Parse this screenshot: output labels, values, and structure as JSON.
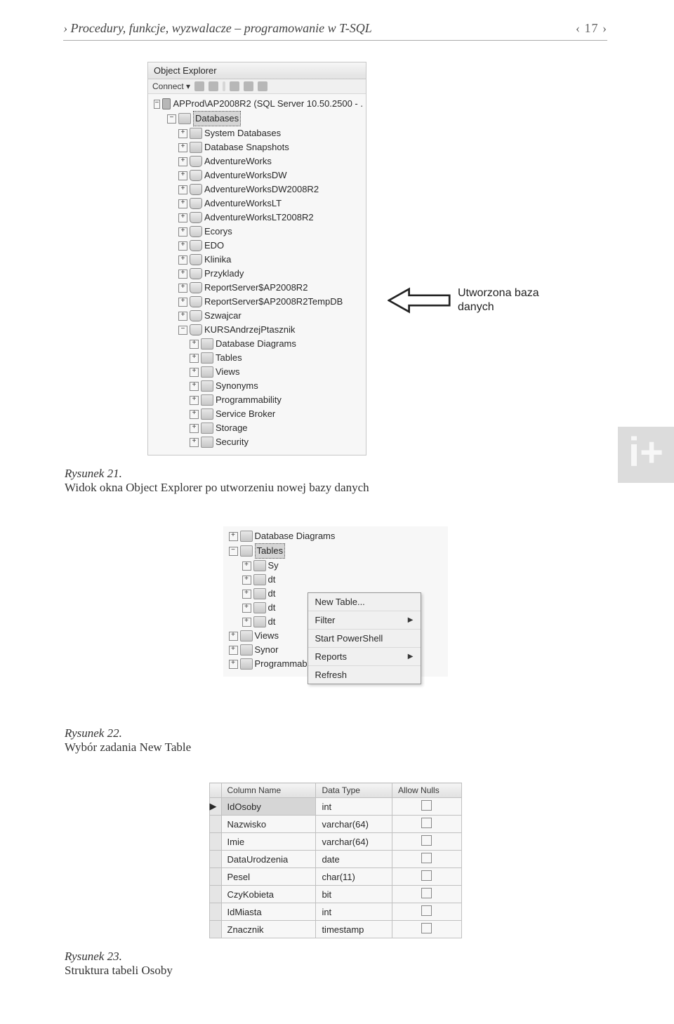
{
  "header": {
    "title": "Procedury, funkcje, wyzwalacze – programowanie w T-SQL",
    "page_number": "‹ 17 ›"
  },
  "captions": {
    "fig21_num": "Rysunek 21.",
    "fig21_text": "Widok okna Object Explorer po utworzeniu nowej bazy danych",
    "fig22_num": "Rysunek 22.",
    "fig22_text": "Wybór zadania New Table",
    "fig23_num": "Rysunek 23.",
    "fig23_text": "Struktura tabeli Osoby"
  },
  "callout": {
    "text": "Utworzona baza danych"
  },
  "object_explorer": {
    "title": "Object Explorer",
    "connect_label": "Connect ▾",
    "server": "APProd\\AP2008R2 (SQL Server 10.50.2500 - .",
    "databases_label": "Databases",
    "system_databases": "System Databases",
    "snapshots": "Database Snapshots",
    "dbs": [
      "AdventureWorks",
      "AdventureWorksDW",
      "AdventureWorksDW2008R2",
      "AdventureWorksLT",
      "AdventureWorksLT2008R2",
      "Ecorys",
      "EDO",
      "Klinika",
      "Przyklady",
      "ReportServer$AP2008R2",
      "ReportServer$AP2008R2TempDB",
      "Szwajcar",
      "KURSAndrzejPtasznik"
    ],
    "db_children": [
      "Database Diagrams",
      "Tables",
      "Views",
      "Synonyms",
      "Programmability",
      "Service Broker",
      "Storage",
      "Security"
    ]
  },
  "fig22_tree": {
    "diagrams": "Database Diagrams",
    "tables": "Tables",
    "partial": [
      "Sy",
      "dt",
      "dt",
      "dt",
      "dt"
    ],
    "views": "Views",
    "synor": "Synor",
    "programmability": "Programmability"
  },
  "context_menu": {
    "items": [
      {
        "label": "New Table...",
        "arrow": false
      },
      {
        "label": "Filter",
        "arrow": true
      },
      {
        "label": "Start PowerShell",
        "arrow": false
      },
      {
        "label": "Reports",
        "arrow": true
      },
      {
        "label": "Refresh",
        "arrow": false
      }
    ]
  },
  "table_designer": {
    "headers": [
      "Column Name",
      "Data Type",
      "Allow Nulls"
    ],
    "rows": [
      {
        "name": "IdOsoby",
        "type": "int",
        "selected": true
      },
      {
        "name": "Nazwisko",
        "type": "varchar(64)"
      },
      {
        "name": "Imie",
        "type": "varchar(64)"
      },
      {
        "name": "DataUrodzenia",
        "type": "date"
      },
      {
        "name": "Pesel",
        "type": "char(11)"
      },
      {
        "name": "CzyKobieta",
        "type": "bit"
      },
      {
        "name": "IdMiasta",
        "type": "int"
      },
      {
        "name": "Znacznik",
        "type": "timestamp"
      }
    ]
  }
}
